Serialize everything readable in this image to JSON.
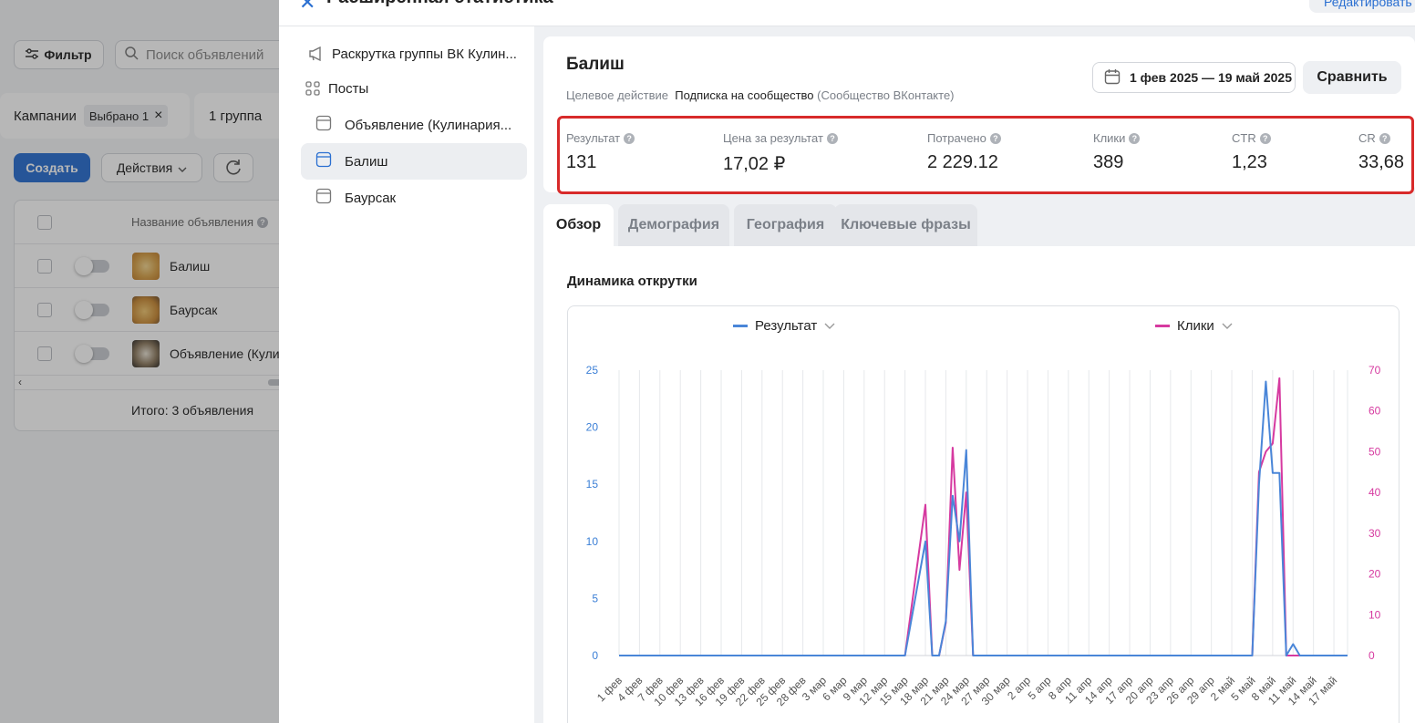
{
  "background": {
    "filter_label": "Фильтр",
    "search_placeholder": "Поиск объявлений",
    "campaigns_tab": "Кампании",
    "selected_chip": "Выбрано 1",
    "group_tab": "1 группа",
    "create_label": "Создать",
    "actions_label": "Действия",
    "column_name": "Название объявления",
    "rows": [
      {
        "name": "Балиш"
      },
      {
        "name": "Баурсак"
      },
      {
        "name": "Объявление (Кулинария..."
      }
    ],
    "total": "Итого: 3 объявления"
  },
  "panel": {
    "title": "Расширенная статистика",
    "edit_label": "Редактировать"
  },
  "sidebar": {
    "items": [
      {
        "label": "Раскрутка группы ВК Кулин...",
        "icon": "megaphone-icon"
      },
      {
        "label": "Посты",
        "icon": "grid-icon"
      },
      {
        "label": "Объявление (Кулинария...",
        "icon": "ad-icon"
      },
      {
        "label": "Балиш",
        "icon": "ad-icon",
        "active": true
      },
      {
        "label": "Баурсак",
        "icon": "ad-icon"
      }
    ]
  },
  "header": {
    "title": "Балиш",
    "target_label": "Целевое действие",
    "target_value": "Подписка на сообщество",
    "target_source": "(Сообщество ВКонтакте)",
    "date_range": "1 фев 2025 — 19 май 2025",
    "compare_label": "Сравнить"
  },
  "metrics": [
    {
      "label": "Результат",
      "value": "131"
    },
    {
      "label": "Цена за результат",
      "value": "17,02 ₽"
    },
    {
      "label": "Потрачено",
      "value": "2 229.12"
    },
    {
      "label": "Клики",
      "value": "389"
    },
    {
      "label": "CTR",
      "value": "1,23"
    },
    {
      "label": "CR",
      "value": "33,68"
    }
  ],
  "tabs": [
    {
      "label": "Обзор",
      "active": true
    },
    {
      "label": "Демография"
    },
    {
      "label": "География"
    },
    {
      "label": "Ключевые фразы"
    }
  ],
  "chart_title": "Динамика открутки",
  "colors": {
    "result": "#4a86d8",
    "clicks": "#d63aa0",
    "accent": "#2a6fd1",
    "highlight": "#d82a2a"
  },
  "chart_data": {
    "type": "line",
    "legend": [
      {
        "name": "Результат",
        "color": "#4a86d8"
      },
      {
        "name": "Клики",
        "color": "#d63aa0"
      }
    ],
    "y_left": {
      "ticks": [
        0,
        5,
        10,
        15,
        20,
        25
      ],
      "range": [
        0,
        25
      ]
    },
    "y_right": {
      "ticks": [
        0,
        10,
        20,
        30,
        40,
        50,
        60,
        70
      ],
      "range": [
        0,
        70
      ]
    },
    "x_labels": [
      "1 фев",
      "4 фев",
      "7 фев",
      "10 фев",
      "13 фев",
      "16 фев",
      "19 фев",
      "22 фев",
      "25 фев",
      "28 фев",
      "3 мар",
      "6 мар",
      "9 мар",
      "12 мар",
      "15 мар",
      "18 мар",
      "21 мар",
      "24 мар",
      "27 мар",
      "30 мар",
      "2 апр",
      "5 апр",
      "8 апр",
      "11 апр",
      "14 апр",
      "17 апр",
      "20 апр",
      "23 апр",
      "26 апр",
      "29 апр",
      "2 май",
      "5 май",
      "8 май",
      "11 май",
      "14 май",
      "17 май"
    ],
    "series": [
      {
        "name": "Результат",
        "axis": "left",
        "points": [
          [
            0,
            0
          ],
          [
            42,
            0
          ],
          [
            45,
            10
          ],
          [
            46,
            0
          ],
          [
            47,
            0
          ],
          [
            48,
            3
          ],
          [
            49,
            14
          ],
          [
            50,
            10
          ],
          [
            51,
            18
          ],
          [
            52,
            0
          ],
          [
            93,
            0
          ],
          [
            94,
            15
          ],
          [
            95,
            24
          ],
          [
            96,
            16
          ],
          [
            97,
            16
          ],
          [
            98,
            0
          ],
          [
            99,
            1
          ],
          [
            100,
            0
          ],
          [
            107,
            0
          ]
        ]
      },
      {
        "name": "Клики",
        "axis": "right",
        "points": [
          [
            0,
            0
          ],
          [
            42,
            0
          ],
          [
            45,
            37
          ],
          [
            46,
            0
          ],
          [
            47,
            0
          ],
          [
            48,
            8
          ],
          [
            49,
            51
          ],
          [
            50,
            21
          ],
          [
            51,
            40
          ],
          [
            52,
            0
          ],
          [
            93,
            0
          ],
          [
            94,
            45
          ],
          [
            95,
            50
          ],
          [
            96,
            52
          ],
          [
            97,
            68
          ],
          [
            98,
            0
          ],
          [
            99,
            0
          ],
          [
            100,
            0
          ],
          [
            107,
            0
          ]
        ]
      }
    ]
  }
}
